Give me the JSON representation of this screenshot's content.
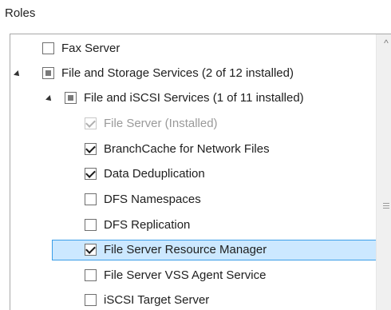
{
  "header": {
    "title": "Roles"
  },
  "roles": [
    {
      "label": "Fax Server",
      "state": "unchecked",
      "expander": "none",
      "level": 1
    },
    {
      "label": "File and Storage Services (2 of 12 installed)",
      "state": "partial",
      "expander": "expanded",
      "level": 1
    },
    {
      "label": "File and iSCSI Services (1 of 11 installed)",
      "state": "partial",
      "expander": "expanded",
      "level": 2
    },
    {
      "label": "File Server (Installed)",
      "state": "checked-disabled",
      "expander": "none",
      "level": 3
    },
    {
      "label": "BranchCache for Network Files",
      "state": "checked",
      "expander": "none",
      "level": 3
    },
    {
      "label": "Data Deduplication",
      "state": "checked",
      "expander": "none",
      "level": 3
    },
    {
      "label": "DFS Namespaces",
      "state": "unchecked",
      "expander": "none",
      "level": 3
    },
    {
      "label": "DFS Replication",
      "state": "unchecked",
      "expander": "none",
      "level": 3
    },
    {
      "label": "File Server Resource Manager",
      "state": "checked",
      "expander": "none",
      "level": 3,
      "selected": true
    },
    {
      "label": "File Server VSS Agent Service",
      "state": "unchecked",
      "expander": "none",
      "level": 3
    },
    {
      "label": "iSCSI Target Server",
      "state": "unchecked",
      "expander": "none",
      "level": 3
    }
  ],
  "scrollbar": {
    "up_arrow": "^"
  }
}
